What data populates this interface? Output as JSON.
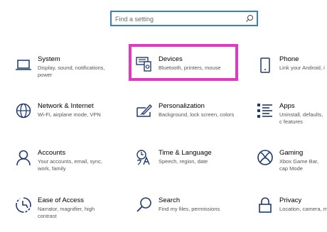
{
  "search": {
    "placeholder": "Find a setting",
    "icon": "search-icon"
  },
  "highlight_color": "#e338c1",
  "accent_color": "#3a7fc4",
  "tiles": [
    {
      "id": "system",
      "icon": "laptop-icon",
      "title": "System",
      "desc": "Display, sound, notifications, power"
    },
    {
      "id": "devices",
      "icon": "keyboard-speaker-icon",
      "title": "Devices",
      "desc": "Bluetooth, printers, mouse"
    },
    {
      "id": "phone",
      "icon": "phone-icon",
      "title": "Phone",
      "desc": "Link your Android, i"
    },
    {
      "id": "network",
      "icon": "globe-icon",
      "title": "Network & Internet",
      "desc": "Wi-Fi, airplane mode, VPN"
    },
    {
      "id": "personalization",
      "icon": "paintbrush-icon",
      "title": "Personalization",
      "desc": "Background, lock screen, colors"
    },
    {
      "id": "apps",
      "icon": "apps-list-icon",
      "title": "Apps",
      "desc": "Uninstall, defaults, c features"
    },
    {
      "id": "accounts",
      "icon": "person-icon",
      "title": "Accounts",
      "desc": "Your accounts, email, sync, work, family"
    },
    {
      "id": "time",
      "icon": "time-language-icon",
      "title": "Time & Language",
      "desc": "Speech, region, date"
    },
    {
      "id": "gaming",
      "icon": "xbox-icon",
      "title": "Gaming",
      "desc": "Xbox Game Bar, cap Mode"
    },
    {
      "id": "ease",
      "icon": "ease-of-access-icon",
      "title": "Ease of Access",
      "desc": "Narrator, magnifier, high contrast"
    },
    {
      "id": "search",
      "icon": "magnifier-icon",
      "title": "Search",
      "desc": "Find my files, permissions"
    },
    {
      "id": "privacy",
      "icon": "lock-icon",
      "title": "Privacy",
      "desc": "Location, camera, m"
    }
  ]
}
